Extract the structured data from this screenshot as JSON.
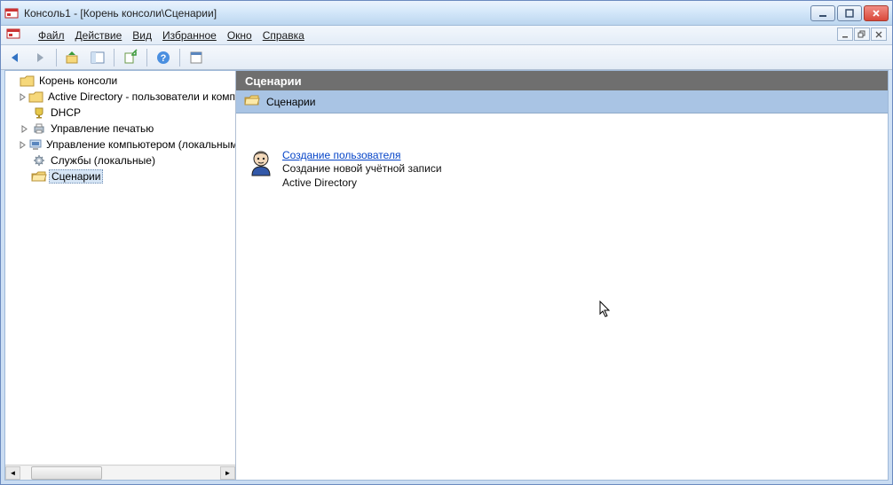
{
  "window": {
    "title": "Консоль1 - [Корень консоли\\Сценарии]"
  },
  "menu": {
    "file": "Файл",
    "action": "Действие",
    "view": "Вид",
    "favorites": "Избранное",
    "window": "Окно",
    "help": "Справка"
  },
  "tree": {
    "root": "Корень консоли",
    "items": [
      {
        "label": "Active Directory - пользователи и компьютеры",
        "icon": "folder",
        "expandable": true
      },
      {
        "label": "DHCP",
        "icon": "trophy",
        "expandable": false
      },
      {
        "label": "Управление печатью",
        "icon": "printer",
        "expandable": true
      },
      {
        "label": "Управление компьютером (локальным)",
        "icon": "computer",
        "expandable": true
      },
      {
        "label": "Службы (локальные)",
        "icon": "gear",
        "expandable": false
      },
      {
        "label": "Сценарии",
        "icon": "folder-open",
        "expandable": false,
        "selected": true
      }
    ]
  },
  "content": {
    "header": "Сценарии",
    "subheader": "Сценарии",
    "item": {
      "link": "Создание пользователя",
      "desc_line1": "Создание новой учётной записи",
      "desc_line2": "Active Directory"
    }
  }
}
